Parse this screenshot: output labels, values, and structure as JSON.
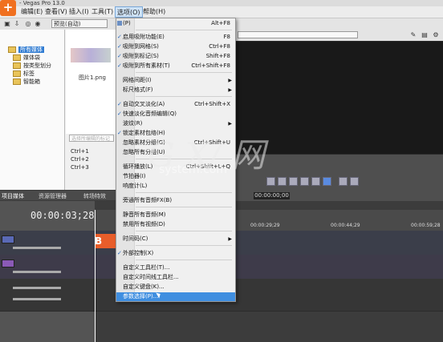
{
  "window": {
    "title": "- Vegas Pro 13.0"
  },
  "menubar": {
    "items": [
      "编辑(E)",
      "查看(V)",
      "插入(I)",
      "工具(T)",
      "选项(O)",
      "帮助(H)"
    ]
  },
  "toolbar": {
    "media_dropdown": "预览(自动)"
  },
  "explorer": {
    "tree": [
      "所有媒体",
      "媒体袋",
      "按类型划分",
      "标签",
      "智能箱"
    ],
    "thumbnail_label": "图片1.png",
    "search_placeholder": "选择所编辑的标记",
    "key_lines": [
      "Ctrl+1",
      "Ctrl+2",
      "Ctrl+3"
    ]
  },
  "tabs": [
    "项目媒体",
    "资源管理器",
    "转场特效"
  ],
  "timeline": {
    "timecode": "00:00:03;28",
    "ruler_labels": [
      "00:00:29;29",
      "00:00:44;29",
      "00:00:59;28"
    ],
    "small_timecode": "00:00:00;00",
    "clip_text": "B"
  },
  "options_menu": {
    "items": [
      {
        "label": "(P)",
        "shortcut": "Alt+F8",
        "icon": "play-icon"
      },
      {
        "label": "启用吸附功能(E)",
        "shortcut": "F8",
        "check": true
      },
      {
        "label": "吸附到网格(S)",
        "shortcut": "Ctrl+F8",
        "check": true
      },
      {
        "label": "吸附到标记(S)",
        "shortcut": "Shift+F8",
        "check": true
      },
      {
        "label": "吸附到所有素材(T)",
        "shortcut": "Ctrl+Shift+F8",
        "check": true
      },
      {
        "label": "网格间距(I)",
        "submenu": true
      },
      {
        "label": "标尺格式(F)",
        "submenu": true
      },
      {
        "label": "自动交叉淡化(A)",
        "shortcut": "Ctrl+Shift+X",
        "check": true
      },
      {
        "label": "快速淡化音频编辑(Q)",
        "check": true
      },
      {
        "label": "波纹(R)",
        "submenu": true
      },
      {
        "label": "锁定素材包络(H)",
        "check": true
      },
      {
        "label": "忽略素材分组(G)",
        "shortcut": "Ctrl+Shift+U"
      },
      {
        "label": "忽略所有分组(U)"
      },
      {
        "label": "循环播放(L)",
        "shortcut": "Ctrl+Shift+L+Q"
      },
      {
        "label": "节拍器(I)"
      },
      {
        "label": "响度计(L)"
      },
      {
        "label": "旁通所有音频FX(B)"
      },
      {
        "label": "静音所有音频(M)"
      },
      {
        "label": "禁用所有视频(D)"
      },
      {
        "label": "时间码(C)",
        "submenu": true
      },
      {
        "label": "外部控制(X)",
        "check": true
      },
      {
        "label": "自定义工具栏(T)..."
      },
      {
        "label": "自定义时间线工具栏..."
      },
      {
        "label": "自定义键盘(K)..."
      },
      {
        "label": "参数选择(P)...",
        "highlight": true
      }
    ]
  },
  "watermark": {
    "main": "G X/ 网",
    "sub": "system.com"
  },
  "colors": {
    "highlight": "#3f8ee0",
    "menu_bg": "#f0f0f0",
    "clip": "#e85d2a"
  }
}
